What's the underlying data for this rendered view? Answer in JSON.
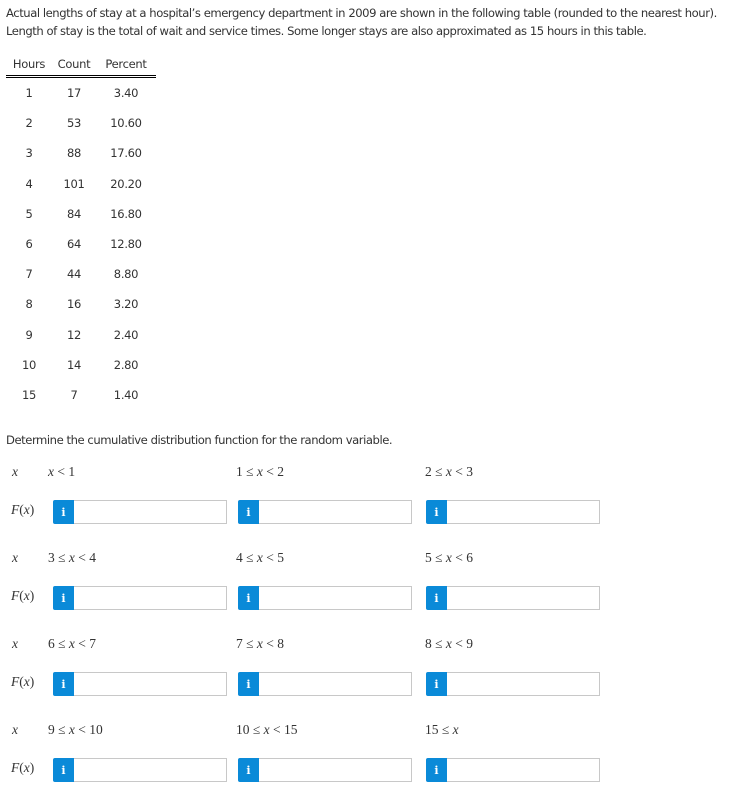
{
  "intro": {
    "line1": "Actual lengths of stay at a hospital’s emergency department in 2009 are shown in the following table (rounded to the nearest hour).",
    "line2": "Length of stay is the total of wait and service times. Some longer stays are also approximated as 15 hours in this table."
  },
  "table": {
    "headers": [
      "Hours",
      "Count",
      "Percent"
    ],
    "rows": [
      [
        "1",
        "17",
        "3.40"
      ],
      [
        "2",
        "53",
        "10.60"
      ],
      [
        "3",
        "88",
        "17.60"
      ],
      [
        "4",
        "101",
        "20.20"
      ],
      [
        "5",
        "84",
        "16.80"
      ],
      [
        "6",
        "64",
        "12.80"
      ],
      [
        "7",
        "44",
        "8.80"
      ],
      [
        "8",
        "16",
        "3.20"
      ],
      [
        "9",
        "12",
        "2.40"
      ],
      [
        "10",
        "14",
        "2.80"
      ],
      [
        "15",
        "7",
        "1.40"
      ]
    ]
  },
  "prompt": "Determine the cumulative distribution function for the random variable.",
  "cdf": {
    "x_label": "x",
    "fx_label": "F(x)",
    "info_icon_glyph": "i",
    "info_color": "#0a8ad8",
    "groups": [
      {
        "ranges": [
          "x < 1",
          "1 ≤ x < 2",
          "2 ≤ x < 3"
        ],
        "values": [
          "",
          "",
          ""
        ]
      },
      {
        "ranges": [
          "3 ≤ x < 4",
          "4 ≤ x < 5",
          "5 ≤ x < 6"
        ],
        "values": [
          "",
          "",
          ""
        ]
      },
      {
        "ranges": [
          "6 ≤ x < 7",
          "7 ≤ x < 8",
          "8 ≤ x < 9"
        ],
        "values": [
          "",
          "",
          ""
        ]
      },
      {
        "ranges": [
          "9 ≤ x < 10",
          "10 ≤ x < 15",
          "15 ≤ x"
        ],
        "values": [
          "",
          "",
          ""
        ]
      }
    ]
  }
}
